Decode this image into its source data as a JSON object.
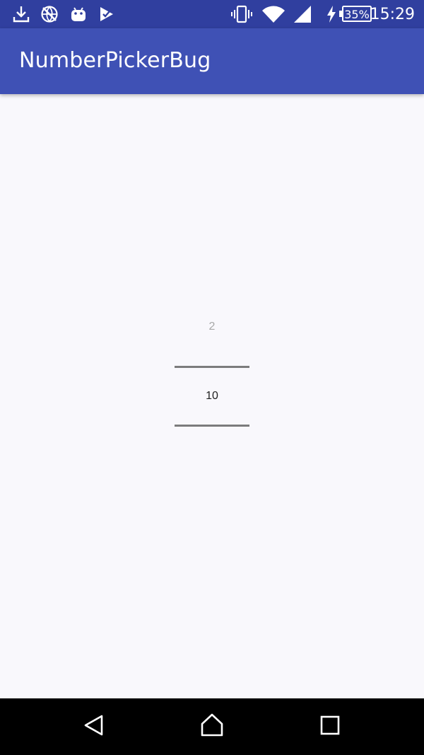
{
  "status_bar": {
    "time": "15:29",
    "battery_percent": "35%",
    "left_icons": [
      "download-icon",
      "no-globe-icon",
      "android-icon",
      "check-app-icon"
    ],
    "right_icons": [
      "vibrate-icon",
      "wifi-icon",
      "cell-signal-icon",
      "charging-icon",
      "battery-icon"
    ]
  },
  "app_bar": {
    "title": "NumberPickerBug"
  },
  "number_picker": {
    "previous_value": "2",
    "current_value": "10"
  },
  "nav_bar": {
    "buttons": [
      "back-icon",
      "home-icon",
      "recents-icon"
    ]
  },
  "colors": {
    "status_bar": "#303f9f",
    "app_bar": "#3f51b5",
    "background": "#f9f8fc",
    "divider": "#7c7c7c"
  }
}
